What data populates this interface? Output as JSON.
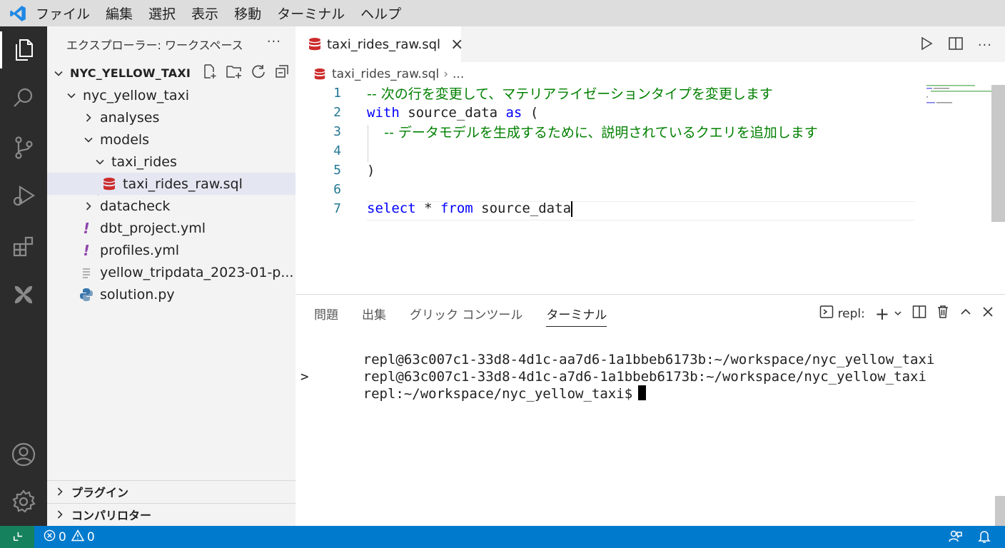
{
  "menubar": {
    "items": [
      "ファイル",
      "編集",
      "選択",
      "表示",
      "移動",
      "ターミナル",
      "ヘルプ"
    ]
  },
  "activity_bar": {
    "icons": [
      "files-icon",
      "search-icon",
      "source-control-icon",
      "run-debug-icon",
      "extensions-icon",
      "dbt-icon",
      "account-icon",
      "settings-gear-icon"
    ]
  },
  "sidebar": {
    "title": "エクスプローラー: ワークスペース",
    "more": "···",
    "workspace": "NYC_YELLOW_TAXI",
    "tree": [
      {
        "label": "nyc_yellow_taxi",
        "depth": 1,
        "kind": "folder",
        "expanded": true
      },
      {
        "label": "analyses",
        "depth": 2,
        "kind": "folder",
        "expanded": false
      },
      {
        "label": "models",
        "depth": 2,
        "kind": "folder",
        "expanded": true
      },
      {
        "label": "taxi_rides",
        "depth": 3,
        "kind": "folder",
        "expanded": true
      },
      {
        "label": "taxi_rides_raw.sql",
        "depth": 4,
        "kind": "sql",
        "selected": true
      },
      {
        "label": "datacheck",
        "depth": 2,
        "kind": "folder",
        "expanded": false
      },
      {
        "label": "dbt_project.yml",
        "depth": 2,
        "kind": "yml"
      },
      {
        "label": "profiles.yml",
        "depth": 2,
        "kind": "yml"
      },
      {
        "label": "yellow_tripdata_2023-01-p...",
        "depth": 2,
        "kind": "text"
      },
      {
        "label": "solution.py",
        "depth": 2,
        "kind": "python"
      }
    ],
    "sections": [
      "プラグイン",
      "コンパリロター"
    ]
  },
  "editor": {
    "tab_label": "taxi_rides_raw.sql",
    "breadcrumb": {
      "file": "taxi_rides_raw.sql",
      "sep": "›",
      "rest": "..."
    },
    "lines": [
      {
        "n": "1",
        "tokens": [
          {
            "t": "-- 次の行を変更して、マテリアライゼーションタイプを変更します",
            "c": "comment"
          }
        ]
      },
      {
        "n": "2",
        "tokens": [
          {
            "t": "with",
            "c": "kw"
          },
          {
            "t": " source_data ",
            "c": "plain"
          },
          {
            "t": "as",
            "c": "kw"
          },
          {
            "t": " (",
            "c": "plain"
          }
        ]
      },
      {
        "n": "3",
        "tokens": [
          {
            "t": "    -- データモデルを生成するために、説明されているクエリを追加します",
            "c": "comment"
          }
        ]
      },
      {
        "n": "4",
        "tokens": []
      },
      {
        "n": "5",
        "tokens": [
          {
            "t": ")",
            "c": "plain"
          }
        ]
      },
      {
        "n": "6",
        "tokens": []
      },
      {
        "n": "7",
        "tokens": [
          {
            "t": "select",
            "c": "kw"
          },
          {
            "t": " * ",
            "c": "plain"
          },
          {
            "t": "from",
            "c": "kw"
          },
          {
            "t": " source_data",
            "c": "plain"
          }
        ]
      }
    ]
  },
  "panel": {
    "tabs": [
      "問題",
      "出集",
      "グリック コンツール",
      "ターミナル"
    ],
    "active_tab": "ターミナル",
    "terminal_label": "repl:",
    "terminal_lines": [
      {
        "prefix": "",
        "text": "repl@63c007c1-33d8-4d1c-aa7d6-1a1bbeb6173b:~/workspace/nyc_yellow_taxi"
      },
      {
        "prefix": ">",
        "text": "repl@63c007c1-33d8-4d1c-a7d6-1a1bbeb6173b:~/workspace/nyc_yellow_taxi"
      },
      {
        "prefix": "",
        "text": "repl:~/workspace/nyc_yellow_taxi$"
      }
    ]
  },
  "statusbar": {
    "errors": "0",
    "warnings": "0"
  },
  "colors": {
    "accent": "#007acc",
    "remote": "#16825d",
    "activity_bg": "#2c2c2c",
    "sql_icon": "#cc2b2b",
    "yml_icon": "#8e44ad"
  }
}
